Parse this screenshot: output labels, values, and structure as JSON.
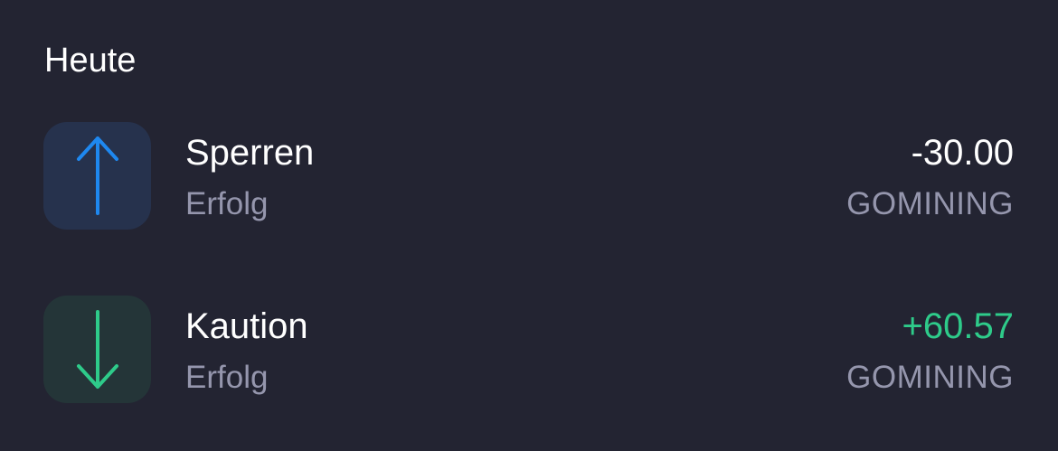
{
  "section": {
    "title": "Heute"
  },
  "transactions": [
    {
      "title": "Sperren",
      "status": "Erfolg",
      "amount": "-30.00",
      "asset": "GOMINING",
      "icon": "arrow-up-icon",
      "icon_color": "#1e88f0",
      "icon_bg": "#26324d",
      "amount_color": "#ffffff"
    },
    {
      "title": "Kaution",
      "status": "Erfolg",
      "amount": "+60.57",
      "asset": "GOMINING",
      "icon": "arrow-down-icon",
      "icon_color": "#2ecb8a",
      "icon_bg": "#243538",
      "amount_color": "#2ecb8a"
    }
  ]
}
